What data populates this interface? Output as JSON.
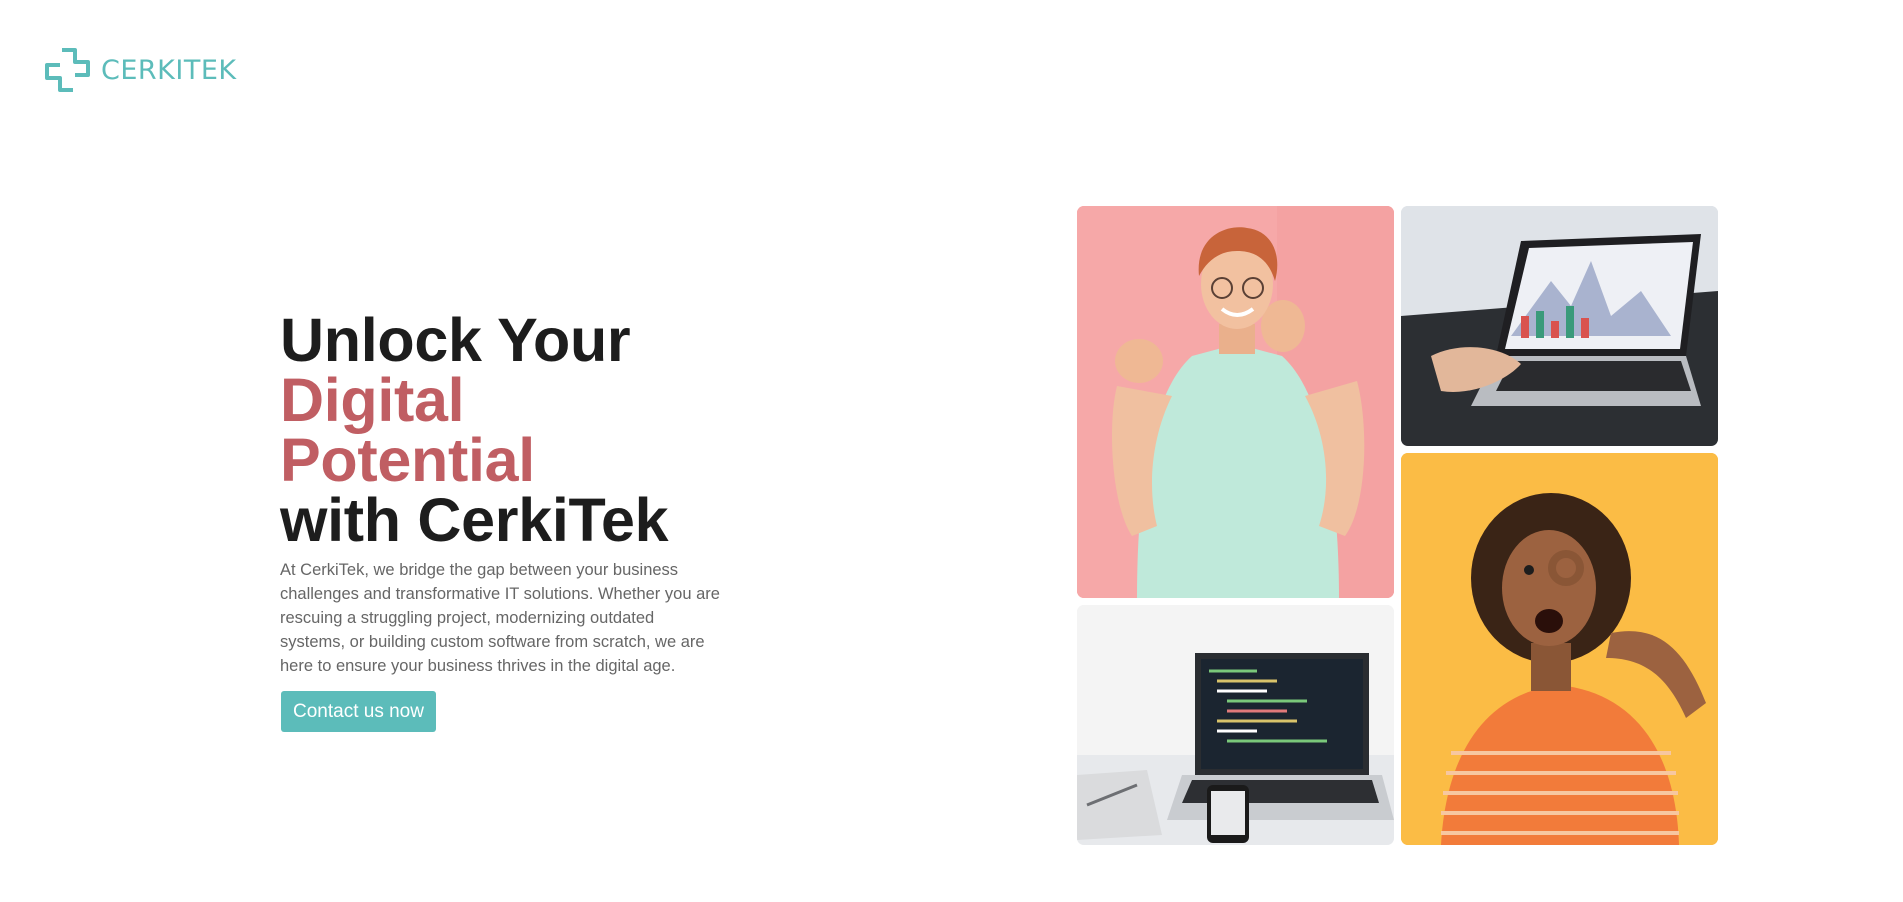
{
  "brand": {
    "name": "CERKITEK",
    "color": "#5cbcba"
  },
  "hero": {
    "headline": {
      "line1": "Unlock Your",
      "line2": "Digital",
      "line3": "Potential",
      "line4": "with CerkiTek"
    },
    "description": "At CerkiTek, we bridge the gap between your business challenges and transformative IT solutions. Whether you are rescuing a struggling project, modernizing outdated systems, or building custom software from scratch, we are here to ensure your business thrives in the digital age.",
    "cta_label": "Contact us now"
  },
  "colors": {
    "accent": "#5cbcba",
    "headline_accent": "#c05e63",
    "headline": "#1d1d1d",
    "body_text": "#666666"
  },
  "gallery": [
    {
      "name": "man-pointing-photo",
      "background": "#f6a8a8"
    },
    {
      "name": "laptop-chart-photo",
      "background": "#d8dde2"
    },
    {
      "name": "laptop-code-photo",
      "background": "#f1f1f1"
    },
    {
      "name": "woman-ok-gesture-photo",
      "background": "#fbbc45"
    }
  ]
}
